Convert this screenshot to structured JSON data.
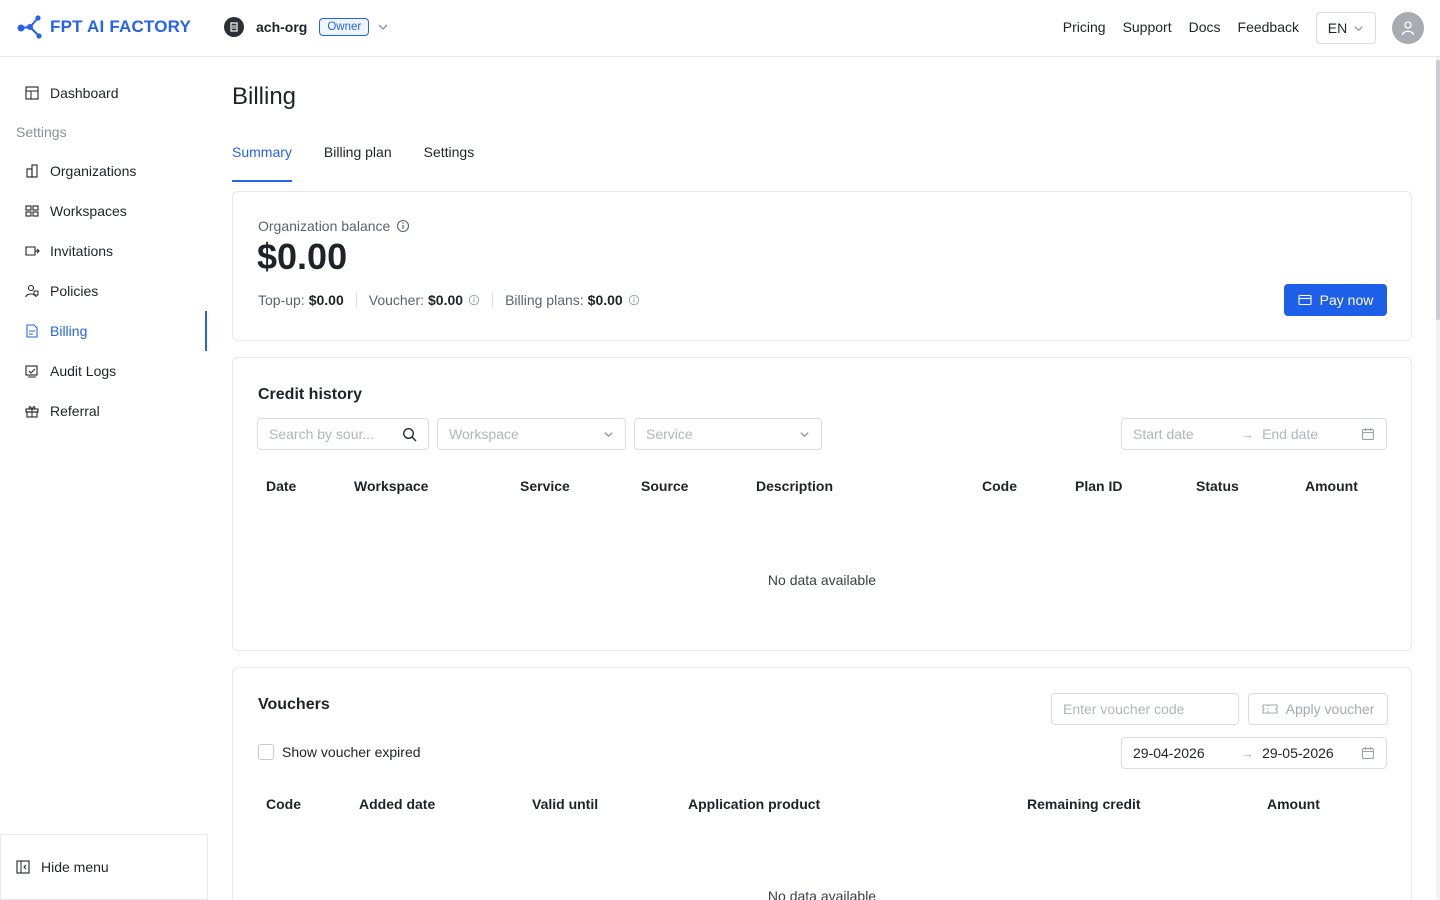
{
  "brand": {
    "name": "FPT AI FACTORY",
    "color": "#2563eb"
  },
  "org": {
    "name": "ach-org",
    "role": "Owner"
  },
  "nav": [
    "Pricing",
    "Support",
    "Docs",
    "Feedback"
  ],
  "lang": "EN",
  "sidebar": {
    "dashboard": "Dashboard",
    "section": "Settings",
    "items": [
      "Organizations",
      "Workspaces",
      "Invitations",
      "Policies",
      "Billing",
      "Audit Logs",
      "Referral"
    ],
    "active": "Billing",
    "hide": "Hide menu"
  },
  "page": {
    "title": "Billing",
    "tabs": [
      "Summary",
      "Billing plan",
      "Settings"
    ],
    "active_tab": "Summary"
  },
  "balance": {
    "label": "Organization balance",
    "value": "$0.00",
    "topup_label": "Top-up:",
    "topup": "$0.00",
    "voucher_label": "Voucher:",
    "voucher": "$0.00",
    "plans_label": "Billing plans:",
    "plans": "$0.00",
    "pay_now": "Pay now"
  },
  "credit": {
    "title": "Credit history",
    "search_placeholder": "Search by sour...",
    "workspace_placeholder": "Workspace",
    "service_placeholder": "Service",
    "start_date": "Start date",
    "end_date": "End date",
    "columns": [
      "Date",
      "Workspace",
      "Service",
      "Source",
      "Description",
      "Code",
      "Plan ID",
      "Status",
      "Amount"
    ],
    "empty": "No data available"
  },
  "vouchers": {
    "title": "Vouchers",
    "code_placeholder": "Enter voucher code",
    "apply": "Apply voucher",
    "show_expired": "Show voucher expired",
    "start_date": "29-04-2026",
    "end_date": "29-05-2026",
    "columns": [
      "Code",
      "Added date",
      "Valid until",
      "Application product",
      "Remaining credit",
      "Amount"
    ],
    "empty": "No data available"
  }
}
